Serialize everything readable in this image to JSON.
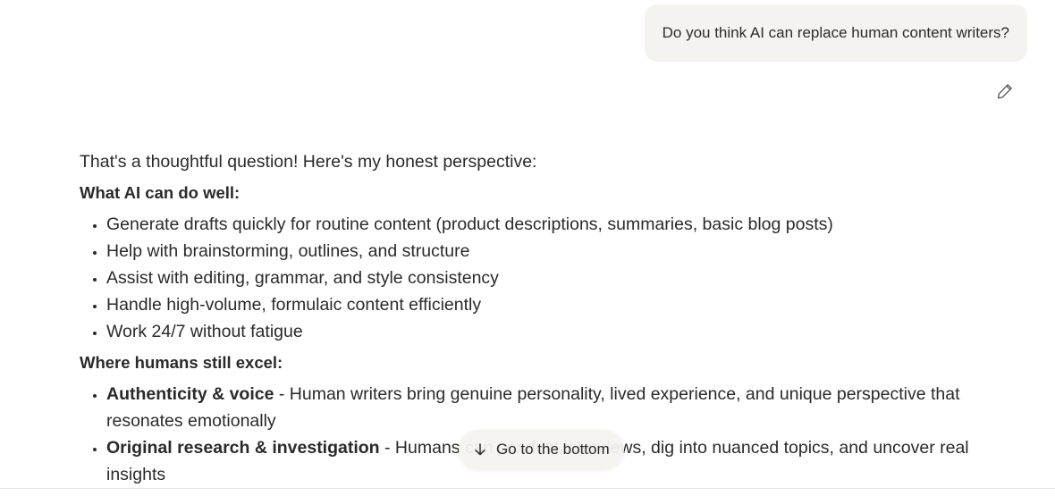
{
  "user_message": "Do you think AI can replace human content writers?",
  "edit_icon": "pencil-icon",
  "reply": {
    "intro": "That's a thoughtful question! Here's my honest perspective:",
    "section1_heading": "What AI can do well:",
    "section1_items": [
      "Generate drafts quickly for routine content (product descriptions, summaries, basic blog posts)",
      "Help with brainstorming, outlines, and structure",
      "Assist with editing, grammar, and style consistency",
      "Handle high-volume, formulaic content efficiently",
      "Work 24/7 without fatigue"
    ],
    "section2_heading": "Where humans still excel:",
    "section2_items": [
      {
        "bold": "Authenticity & voice",
        "text": " - Human writers bring genuine personality, lived experience, and unique perspective that resonates emotionally"
      },
      {
        "bold": "Original research & investigation",
        "text": " - Humans can conduct interviews, dig into nuanced topics, and uncover real insights"
      }
    ]
  },
  "goto_bottom": {
    "label": "Go to the bottom",
    "icon": "arrow-down-icon"
  }
}
